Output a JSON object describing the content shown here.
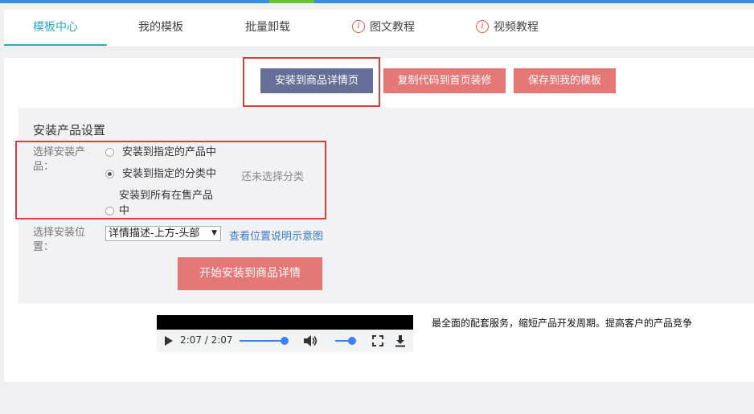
{
  "tabs": [
    {
      "label": "模板中心",
      "active": true
    },
    {
      "label": "我的模板",
      "active": false
    },
    {
      "label": "批量卸载",
      "active": false
    },
    {
      "label": "图文教程",
      "active": false,
      "icon": "info-icon"
    },
    {
      "label": "视频教程",
      "active": false,
      "icon": "info-icon"
    }
  ],
  "actions": {
    "install_detail": "安装到商品详情页",
    "copy_code": "复制代码到首页装修",
    "save_template": "保存到我的模板"
  },
  "settings": {
    "title": "安装产品设置",
    "product_label": "选择安装产品：",
    "radio_products": "安装到指定的产品中",
    "radio_category": "安装到指定的分类中",
    "no_category": "还未选择分类",
    "radio_all_line1": "安装到所有在售产品",
    "radio_all_line2": "中",
    "selected_radio": "category",
    "position_label": "选择安装位置：",
    "position_value": "详情描述-上方-头部",
    "position_link": "查看位置说明示意图",
    "start_button": "开始安装到商品详情"
  },
  "video": {
    "time": "2:07 / 2:07",
    "progress": 1.0,
    "volume": 1.0
  },
  "promo": "最全面的配套服务，缩短产品开发周期。提高客户的产品竞争",
  "colors": {
    "accent": "#2fa8c9",
    "primary_button": "#676f99",
    "red_button": "#e37876",
    "highlight": "#e03a3a",
    "link": "#3a7bbf"
  }
}
